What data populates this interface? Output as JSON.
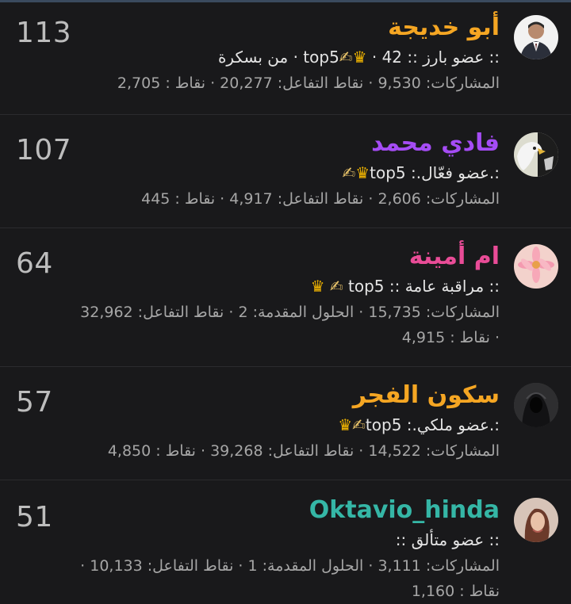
{
  "colors": {
    "background": "#19191b",
    "name_orange": "#f5a623",
    "name_purple": "#a54cf5",
    "name_pink": "#e94c97",
    "name_teal": "#35b6a6",
    "stats_gray": "#a6a6a6"
  },
  "members": [
    {
      "name": "أبو خديجة",
      "count": "113",
      "title_text": ":: عضو بارز :: top5",
      "title_extra": " · 42 · من بسكرة",
      "has_badges": true,
      "stats_line1": "المشاركات: 9,530 · نقاط التفاعل: 20,277 · نقاط : 2,705",
      "stats_line2": "",
      "avatar_icon": "man-in-suit-avatar"
    },
    {
      "name": "فادي محمد",
      "count": "107",
      "title_text": ":.عضو فعّال.: top5",
      "title_extra": "",
      "has_badges": true,
      "stats_line1": "المشاركات: 2,606 · نقاط التفاعل: 4,917 · نقاط : 445",
      "stats_line2": "",
      "avatar_icon": "eagle-avatar"
    },
    {
      "name": "ام أمينة",
      "count": "64",
      "title_text": ":: مراقبة عامة :: top5",
      "title_extra": "",
      "has_badges": true,
      "stats_line1": "المشاركات: 15,735 · الحلول المقدمة: 2 · نقاط التفاعل: 32,962",
      "stats_line2": "· نقاط : 4,915",
      "avatar_icon": "pink-flower-avatar"
    },
    {
      "name": "سكون الفجر",
      "count": "57",
      "title_text": ":.عضو ملكي.: top5",
      "title_extra": "",
      "has_badges": true,
      "stats_line1": "المشاركات: 14,522 · نقاط التفاعل: 39,268 · نقاط : 4,850",
      "stats_line2": "",
      "avatar_icon": "hooded-figure-avatar"
    },
    {
      "name": "Oktavio_hinda",
      "count": "51",
      "title_text": ":: عضو متألق ::",
      "title_extra": "",
      "has_badges": false,
      "stats_line1": "المشاركات: 3,111 · الحلول المقدمة: 1 · نقاط التفاعل: 10,133 ·",
      "stats_line2": "نقاط : 1,160",
      "avatar_icon": "woman-portrait-avatar"
    }
  ]
}
